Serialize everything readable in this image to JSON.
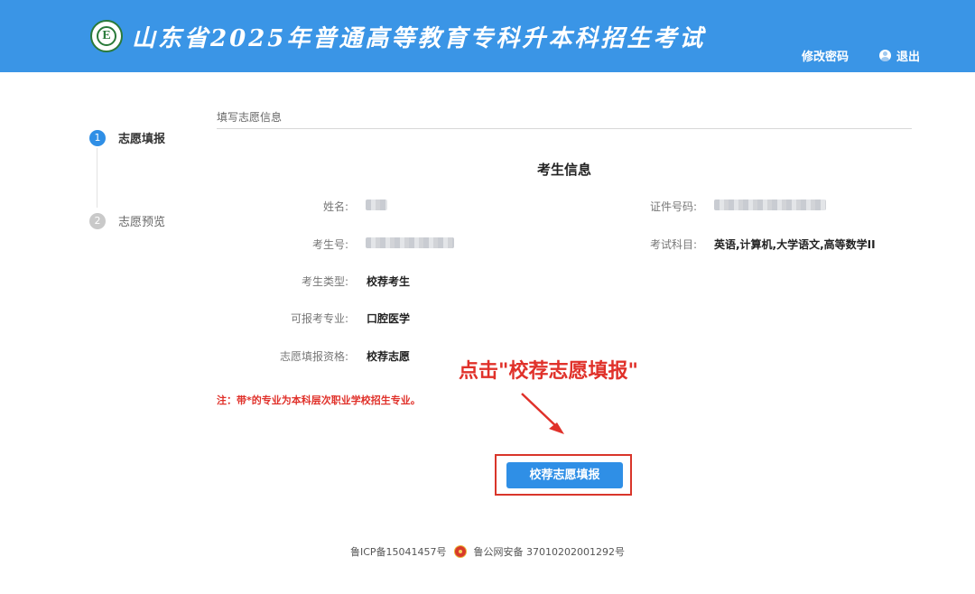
{
  "header": {
    "title": "山东省2025年普通高等教育专科升本科招生考试",
    "logo_letter": "E",
    "change_password": "修改密码",
    "logout": "退出"
  },
  "steps": [
    {
      "num": "1",
      "label": "志愿填报",
      "active": true
    },
    {
      "num": "2",
      "label": "志愿预览",
      "active": false
    }
  ],
  "section": {
    "title": "填写志愿信息",
    "info_title": "考生信息"
  },
  "fields": {
    "name": {
      "label": "姓名:",
      "value": ""
    },
    "id_number": {
      "label": "证件号码:",
      "value": ""
    },
    "exam_number": {
      "label": "考生号:",
      "value": ""
    },
    "subjects": {
      "label": "考试科目:",
      "value": "英语,计算机,大学语文,高等数学II"
    },
    "type": {
      "label": "考生类型:",
      "value": "校荐考生"
    },
    "major": {
      "label": "可报考专业:",
      "value": "口腔医学"
    },
    "qualification": {
      "label": "志愿填报资格:",
      "value": "校荐志愿"
    }
  },
  "note": "注：带*的专业为本科层次职业学校招生专业。",
  "annotation": "点击\"校荐志愿填报\"",
  "submit_button": "校荐志愿填报",
  "footer": {
    "icp": "鲁ICP备15041457号",
    "police": "鲁公网安备 37010202001292号"
  },
  "colors": {
    "header_bg": "#3a95e6",
    "primary": "#2f8fe6",
    "highlight": "#e0312a"
  },
  "icons": {
    "logo": "school-logo-icon",
    "user": "user-icon",
    "police_badge": "police-badge-icon",
    "arrow": "arrow-down-right-icon"
  }
}
